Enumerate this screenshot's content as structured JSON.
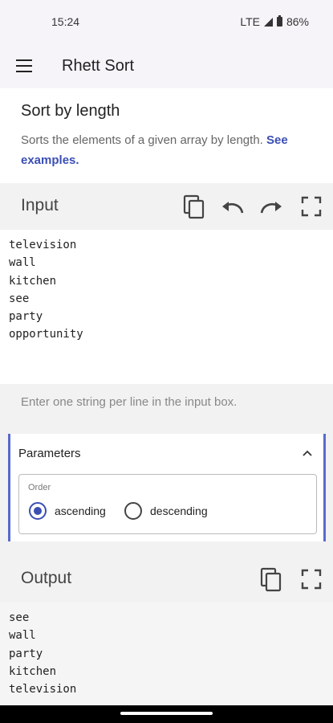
{
  "status_bar": {
    "time": "15:24",
    "network": "LTE",
    "battery": "86%"
  },
  "app_bar": {
    "title": "Rhett Sort"
  },
  "description": {
    "title": "Sort by length",
    "text": "Sorts the elements of a given array by length.",
    "link": "See examples."
  },
  "input": {
    "title": "Input",
    "value": "television\nwall\nkitchen\nsee\nparty\nopportunity",
    "hint": "Enter one string per line in the input box."
  },
  "parameters": {
    "title": "Parameters",
    "order_label": "Order",
    "options": [
      "ascending",
      "descending"
    ],
    "selected": "ascending"
  },
  "output": {
    "title": "Output",
    "value": "see\nwall\nparty\nkitchen\ntelevision"
  },
  "icons": [
    "menu-icon",
    "copy-icon",
    "undo-icon",
    "redo-icon",
    "fullscreen-icon",
    "chevron-up-icon"
  ],
  "colors": {
    "accent": "#3b4fb3",
    "param_border": "#5a6acb"
  }
}
